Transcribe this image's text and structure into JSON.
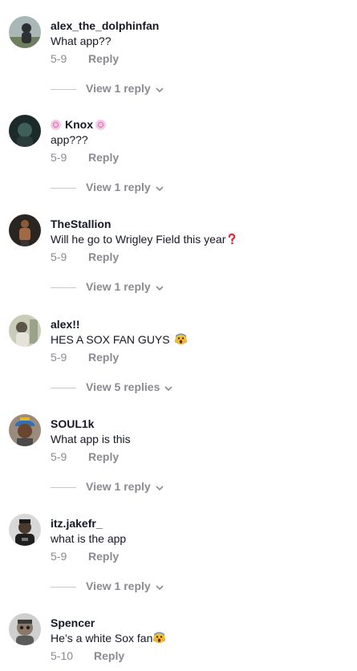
{
  "comments": [
    {
      "username": "alex_the_dolphinfan",
      "text": "What app??",
      "date": "5-9",
      "reply_label": "Reply",
      "view_replies": "View 1 reply"
    },
    {
      "username": "Knox",
      "text": "app???",
      "date": "5-9",
      "reply_label": "Reply",
      "view_replies": "View 1 reply"
    },
    {
      "username": "TheStallion",
      "text": "Will he go to Wrigley Field this year",
      "date": "5-9",
      "reply_label": "Reply",
      "view_replies": "View 1 reply"
    },
    {
      "username": "alex!!",
      "text": "HES A SOX FAN GUYS",
      "date": "5-9",
      "reply_label": "Reply",
      "view_replies": "View 5 replies"
    },
    {
      "username": "SOUL1k",
      "text": "What app is this",
      "date": "5-9",
      "reply_label": "Reply",
      "view_replies": "View 1 reply"
    },
    {
      "username": "itz.jakefr_",
      "text": "what is the app",
      "date": "5-9",
      "reply_label": "Reply",
      "view_replies": "View 1 reply"
    },
    {
      "username": "Spencer",
      "text": "He’s a white Sox fan",
      "date": "5-10",
      "reply_label": "Reply"
    }
  ],
  "icons": {
    "badge": "pink-swirl-badge-icon",
    "question": "red-question-mark-icon",
    "scream": "screaming-face-emoji-icon",
    "chevron": "chevron-down-icon"
  },
  "colors": {
    "text": "#161823",
    "secondary": "#8a8b91",
    "divider": "#c7c8cc"
  }
}
